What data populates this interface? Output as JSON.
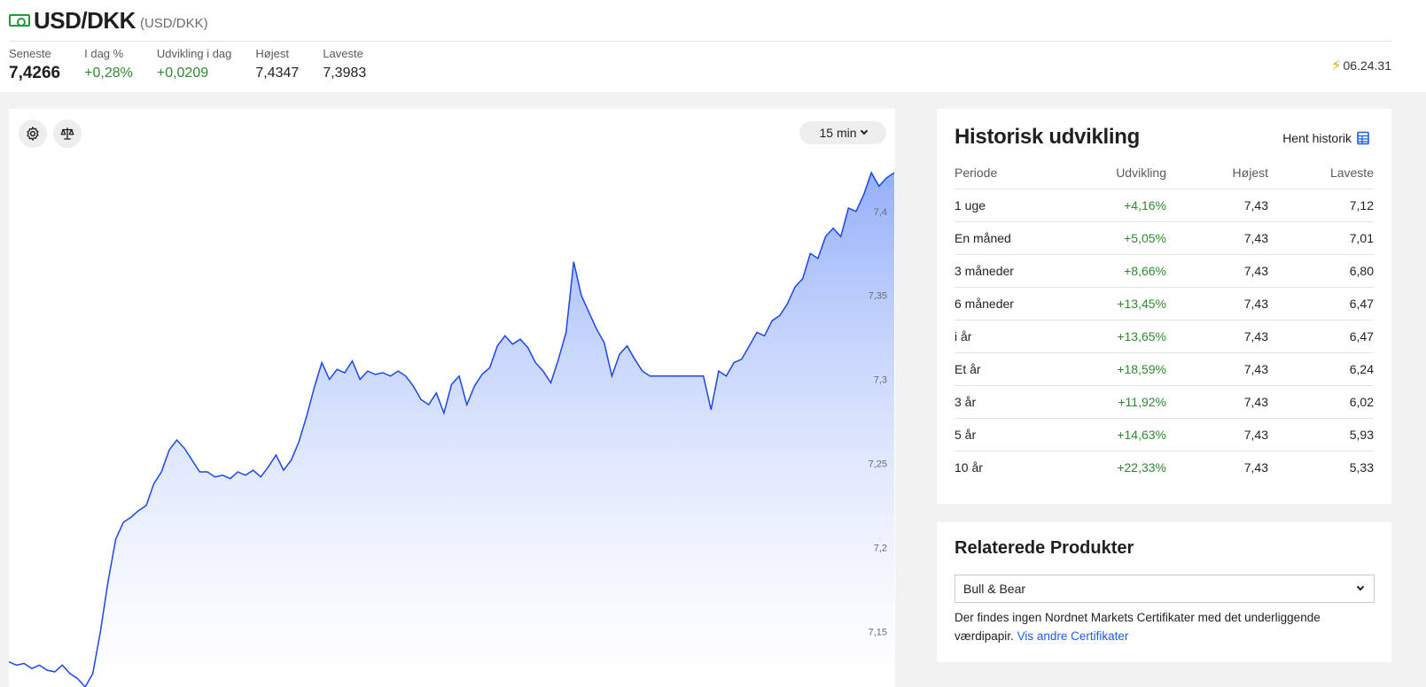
{
  "header": {
    "title": "USD/DKK",
    "subtitle": "(USD/DKK)",
    "stats": [
      {
        "label": "Seneste",
        "value": "7,4266"
      },
      {
        "label": "I dag %",
        "value": "+0,28%"
      },
      {
        "label": "Udvikling i dag",
        "value": "+0,0209"
      },
      {
        "label": "Højest",
        "value": "7,4347"
      },
      {
        "label": "Laveste",
        "value": "7,3983"
      }
    ],
    "time": "06.24.31",
    "colors": {
      "positive": "#2e8a2e",
      "icon": "#1e9a3e"
    }
  },
  "chart": {
    "interval_label": "15 min",
    "settings_icon": "gear-icon",
    "compare_icon": "scale-icon"
  },
  "chart_data": {
    "type": "area",
    "line_color": "#1a47e6",
    "y_ticks": [
      {
        "label": "7,4",
        "value": 7.4
      },
      {
        "label": "7,35",
        "value": 7.35
      },
      {
        "label": "7,3",
        "value": 7.3
      },
      {
        "label": "7,25",
        "value": 7.25
      },
      {
        "label": "7,2",
        "value": 7.2
      },
      {
        "label": "7,15",
        "value": 7.15
      }
    ],
    "ylim": [
      7.117,
      7.461
    ],
    "grid": false,
    "series": [
      {
        "values": [
          7.132,
          7.13,
          7.131,
          7.128,
          7.13,
          7.127,
          7.126,
          7.13,
          7.125,
          7.122,
          7.117,
          7.125,
          7.15,
          7.18,
          7.205,
          7.215,
          7.218,
          7.222,
          7.225,
          7.238,
          7.245,
          7.258,
          7.264,
          7.259,
          7.252,
          7.245,
          7.245,
          7.242,
          7.243,
          7.241,
          7.245,
          7.243,
          7.246,
          7.242,
          7.248,
          7.255,
          7.246,
          7.252,
          7.263,
          7.278,
          7.295,
          7.31,
          7.3,
          7.306,
          7.304,
          7.311,
          7.3,
          7.305,
          7.303,
          7.304,
          7.302,
          7.305,
          7.302,
          7.296,
          7.288,
          7.285,
          7.292,
          7.28,
          7.297,
          7.302,
          7.285,
          7.296,
          7.303,
          7.307,
          7.32,
          7.326,
          7.321,
          7.324,
          7.319,
          7.31,
          7.305,
          7.298,
          7.312,
          7.328,
          7.37,
          7.35,
          7.34,
          7.33,
          7.322,
          7.302,
          7.315,
          7.32,
          7.312,
          7.305,
          7.302,
          7.302,
          7.302,
          7.302,
          7.302,
          7.302,
          7.302,
          7.302,
          7.282,
          7.305,
          7.302,
          7.31,
          7.312,
          7.32,
          7.328,
          7.326,
          7.335,
          7.338,
          7.345,
          7.355,
          7.36,
          7.375,
          7.372,
          7.385,
          7.39,
          7.385,
          7.402,
          7.4,
          7.41,
          7.423,
          7.415,
          7.42,
          7.423
        ]
      }
    ]
  },
  "historic": {
    "title": "Historisk udvikling",
    "link_label": "Hent historik",
    "columns": [
      "Periode",
      "Udvikling",
      "Højest",
      "Laveste"
    ],
    "rows": [
      {
        "period": "1 uge",
        "change": "+4,16%",
        "high": "7,43",
        "low": "7,12"
      },
      {
        "period": "En måned",
        "change": "+5,05%",
        "high": "7,43",
        "low": "7,01"
      },
      {
        "period": "3 måneder",
        "change": "+8,66%",
        "high": "7,43",
        "low": "6,80"
      },
      {
        "period": "6 måneder",
        "change": "+13,45%",
        "high": "7,43",
        "low": "6,47"
      },
      {
        "period": "i år",
        "change": "+13,65%",
        "high": "7,43",
        "low": "6,47"
      },
      {
        "period": "Et år",
        "change": "+18,59%",
        "high": "7,43",
        "low": "6,24"
      },
      {
        "period": "3 år",
        "change": "+11,92%",
        "high": "7,43",
        "low": "6,02"
      },
      {
        "period": "5 år",
        "change": "+14,63%",
        "high": "7,43",
        "low": "5,93"
      },
      {
        "period": "10 år",
        "change": "+22,33%",
        "high": "7,43",
        "low": "5,33"
      }
    ]
  },
  "related": {
    "title": "Relaterede Produkter",
    "select_value": "Bull & Bear",
    "text": "Der findes ingen Nordnet Markets Certifikater med det underliggende værdipapir.",
    "link_label": "Vis andre Certifikater"
  }
}
